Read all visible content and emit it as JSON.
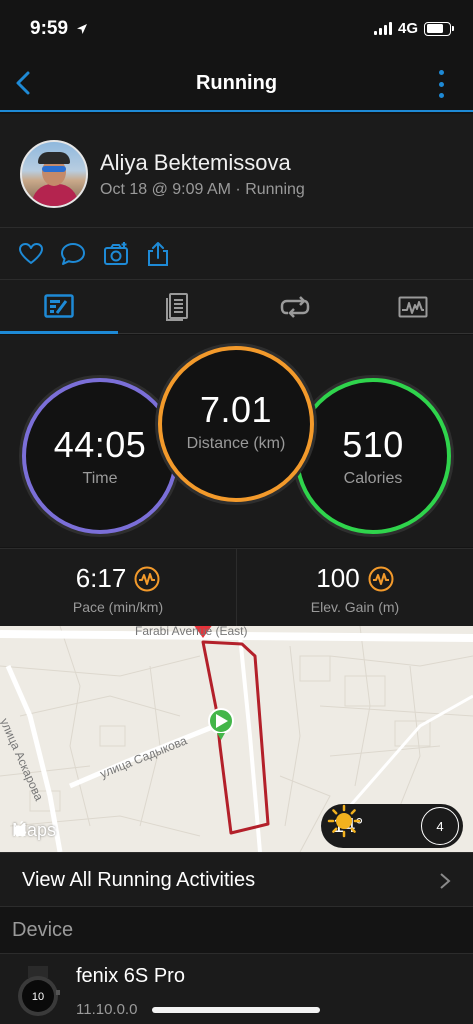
{
  "status_bar": {
    "time": "9:59",
    "network": "4G"
  },
  "nav": {
    "title": "Running"
  },
  "profile": {
    "name": "Aliya Bektemissova",
    "meta": "Oct 18 @ 9:09 AM · Running"
  },
  "stats": {
    "time": {
      "value": "44:05",
      "label": "Time",
      "color": "#7b6fd8"
    },
    "distance": {
      "value": "7.01",
      "label": "Distance (km)",
      "color": "#f39a2b"
    },
    "calories": {
      "value": "510",
      "label": "Calories",
      "color": "#2fd44c"
    }
  },
  "metrics": {
    "pace": {
      "value": "6:17",
      "label": "Pace (min/km)"
    },
    "elevation": {
      "value": "100",
      "label": "Elev. Gain (m)"
    }
  },
  "map": {
    "street_top": "Farabi Avenue (East)",
    "street_left": "улица Аскарова",
    "street_mid": "улица Садыкова",
    "attribution": "Maps",
    "weather_temp": "14°",
    "wind_speed": "4",
    "route_color": "#b3202a"
  },
  "view_all": {
    "label": "View All Running Activities"
  },
  "device_section": {
    "header": "Device"
  },
  "device": {
    "name": "fenix 6S Pro",
    "version": "11.10.0.0",
    "watch_face_number": "10"
  },
  "accent_color": "#1e8ad6"
}
